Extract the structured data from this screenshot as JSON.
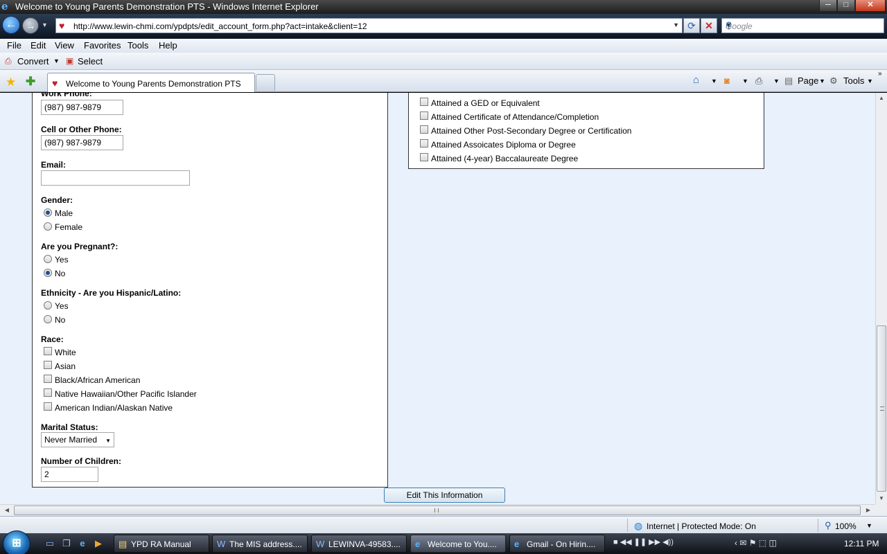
{
  "window": {
    "title": "Welcome to Young Parents Demonstration PTS - Windows Internet Explorer",
    "controls": {
      "minimize": "─",
      "maximize": "□",
      "close": "✕"
    }
  },
  "nav": {
    "url": "http://www.lewin-chmi.com/ypdpts/edit_account_form.php?act=intake&client=12",
    "search_placeholder": "Google"
  },
  "menu": {
    "items": [
      "File",
      "Edit",
      "View",
      "Favorites",
      "Tools",
      "Help"
    ]
  },
  "convert_bar": {
    "convert_label": "Convert",
    "select_label": "Select"
  },
  "tabs": {
    "active_tab": "Welcome to Young Parents Demonstration PTS"
  },
  "command_bar": {
    "page_label": "Page",
    "tools_label": "Tools"
  },
  "form": {
    "work_phone_label": "Work Phone:",
    "work_phone_value": "(987) 987-9879",
    "cell_phone_label": "Cell or Other Phone:",
    "cell_phone_value": "(987) 987-9879",
    "email_label": "Email:",
    "email_value": "",
    "gender": {
      "label": "Gender:",
      "options": [
        "Male",
        "Female"
      ],
      "selected": "Male"
    },
    "pregnant": {
      "label": "Are you Pregnant?:",
      "options": [
        "Yes",
        "No"
      ],
      "selected": "No"
    },
    "ethnicity": {
      "label": "Ethnicity - Are you Hispanic/Latino:",
      "options": [
        "Yes",
        "No"
      ],
      "selected": ""
    },
    "race": {
      "label": "Race:",
      "options": [
        "White",
        "Asian",
        "Black/African American",
        "Native Hawaiian/Other Pacific Islander",
        "American Indian/Alaskan Native"
      ]
    },
    "marital_status": {
      "label": "Marital Status:",
      "value": "Never Married"
    },
    "children": {
      "label": "Number of Children:",
      "value": "2"
    },
    "education": {
      "options": [
        "Attained a GED or Equivalent",
        "Attained Certificate of Attendance/Completion",
        "Attained Other Post-Secondary Degree or Certification",
        "Attained Assoicates Diploma or Degree",
        "Attained (4-year) Baccalaureate Degree"
      ]
    },
    "submit_label": "Edit This Information"
  },
  "status": {
    "zone": "Internet | Protected Mode: On",
    "zoom": "100%"
  },
  "taskbar": {
    "tasks": [
      {
        "label": "YPD RA Manual",
        "icon": "document-icon"
      },
      {
        "label": "The MIS address....",
        "icon": "word-icon"
      },
      {
        "label": "LEWINVA-49583....",
        "icon": "word-icon"
      },
      {
        "label": "Welcome to You....",
        "icon": "ie-icon"
      },
      {
        "label": "Gmail - On Hirin....",
        "icon": "ie-icon"
      }
    ],
    "clock": "12:11 PM"
  }
}
